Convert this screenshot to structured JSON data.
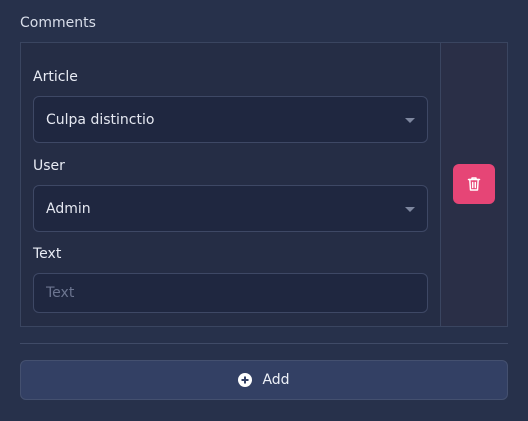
{
  "section": {
    "title": "Comments"
  },
  "comment": {
    "article": {
      "label": "Article",
      "value": "Culpa distinctio"
    },
    "user": {
      "label": "User",
      "value": "Admin"
    },
    "text": {
      "label": "Text",
      "placeholder": "Text",
      "value": ""
    },
    "delete_icon": "trash-icon",
    "delete_color": "#e64576"
  },
  "actions": {
    "add_label": "Add",
    "add_icon": "plus-circle-icon"
  }
}
